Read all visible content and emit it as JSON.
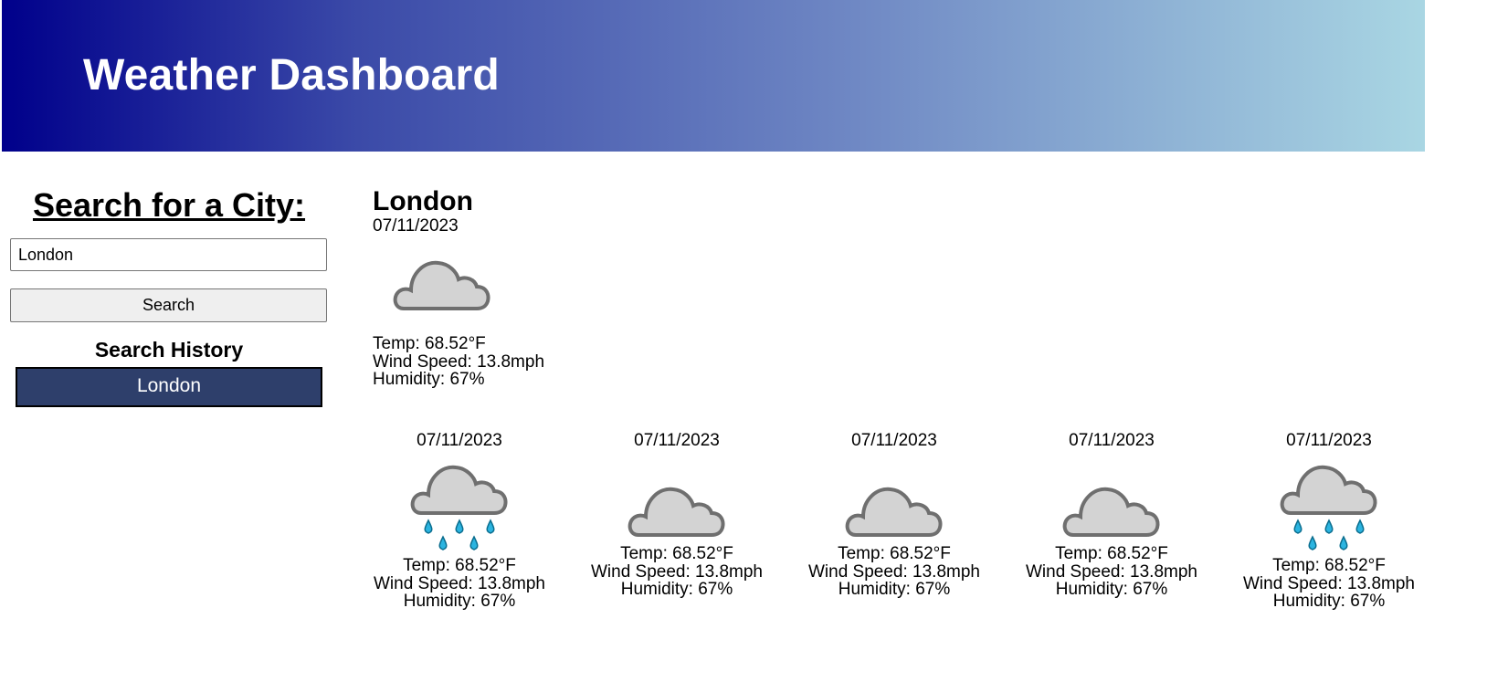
{
  "header": {
    "title": "Weather Dashboard",
    "gradient_start": "#00008b",
    "gradient_end": "#add8e6"
  },
  "sidebar": {
    "search_title": "Search for a City:",
    "search_value": "London",
    "search_button_label": "Search",
    "history_title": "Search History",
    "history_items": [
      "London"
    ],
    "history_item_color": "#2e3f6b"
  },
  "current": {
    "city": "London",
    "date": "07/11/2023",
    "icon": "cloud-icon",
    "temp": "Temp: 68.52°F",
    "wind": "Wind Speed: 13.8mph",
    "humidity": "Humidity: 67%"
  },
  "forecast": [
    {
      "date": "07/11/2023",
      "icon": "rain-cloud-icon",
      "temp": "Temp: 68.52°F",
      "wind": "Wind Speed: 13.8mph",
      "humidity": "Humidity: 67%"
    },
    {
      "date": "07/11/2023",
      "icon": "cloud-icon",
      "temp": "Temp: 68.52°F",
      "wind": "Wind Speed: 13.8mph",
      "humidity": "Humidity: 67%"
    },
    {
      "date": "07/11/2023",
      "icon": "cloud-icon",
      "temp": "Temp: 68.52°F",
      "wind": "Wind Speed: 13.8mph",
      "humidity": "Humidity: 67%"
    },
    {
      "date": "07/11/2023",
      "icon": "cloud-icon",
      "temp": "Temp: 68.52°F",
      "wind": "Wind Speed: 13.8mph",
      "humidity": "Humidity: 67%"
    },
    {
      "date": "07/11/2023",
      "icon": "rain-cloud-icon",
      "temp": "Temp: 68.52°F",
      "wind": "Wind Speed: 13.8mph",
      "humidity": "Humidity: 67%"
    }
  ]
}
